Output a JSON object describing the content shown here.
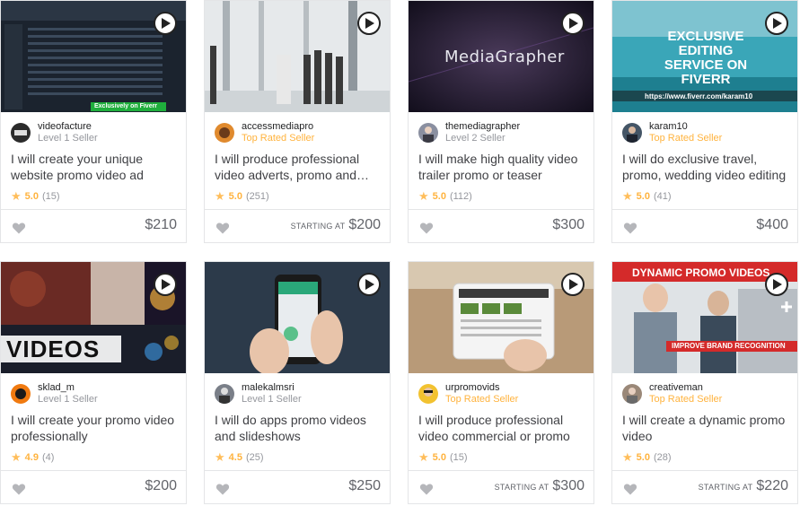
{
  "gigs": [
    {
      "seller": "videofacture",
      "level": "Level 1 Seller",
      "top_rated": false,
      "title": "I will create your unique website promo video ad",
      "rating": "5.0",
      "reviews": "(15)",
      "starting_label": "",
      "price": "$210",
      "thumb_text": "Exclusively on Fiverr",
      "thumb_bg": "#1d2733",
      "avatar_color": "#2b2b2b"
    },
    {
      "seller": "accessmediapro",
      "level": "Top Rated Seller",
      "top_rated": true,
      "title": "I will produce professional video adverts, promo and…",
      "rating": "5.0",
      "reviews": "(251)",
      "starting_label": "STARTING AT",
      "price": "$200",
      "thumb_text": "",
      "thumb_bg": "#d9dde0",
      "avatar_color": "#e08a2e"
    },
    {
      "seller": "themediagrapher",
      "level": "Level 2 Seller",
      "top_rated": false,
      "title": "I will make high quality video trailer promo or teaser",
      "rating": "5.0",
      "reviews": "(112)",
      "starting_label": "",
      "price": "$300",
      "thumb_text": "MediaGrapher",
      "thumb_bg": "#2a1f3a",
      "avatar_color": "#8a8fa0"
    },
    {
      "seller": "karam10",
      "level": "Top Rated Seller",
      "top_rated": true,
      "title": "I will do exclusive travel, promo, wedding video editing",
      "rating": "5.0",
      "reviews": "(41)",
      "starting_label": "",
      "price": "$400",
      "thumb_text": "EXCLUSIVE EDITING SERVICE ON FIVERR",
      "thumb_sub": "https://www.fiverr.com/karam10",
      "thumb_bg": "#2a8fa0",
      "avatar_color": "#445566"
    },
    {
      "seller": "sklad_m",
      "level": "Level 1 Seller",
      "top_rated": false,
      "title": "I will create your promo video professionally",
      "rating": "4.9",
      "reviews": "(4)",
      "starting_label": "",
      "price": "$200",
      "thumb_text": "VIDEOS",
      "thumb_bg": "#3a1e2a",
      "avatar_color": "#f07a10"
    },
    {
      "seller": "malekalmsri",
      "level": "Level 1 Seller",
      "top_rated": false,
      "title": "I will do apps promo videos and slideshows",
      "rating": "4.5",
      "reviews": "(25)",
      "starting_label": "",
      "price": "$250",
      "thumb_text": "",
      "thumb_bg": "#2a3a4a",
      "avatar_color": "#7a7f88"
    },
    {
      "seller": "urpromovids",
      "level": "Top Rated Seller",
      "top_rated": true,
      "title": "I will produce professional video commercial or promo",
      "rating": "5.0",
      "reviews": "(15)",
      "starting_label": "STARTING AT",
      "price": "$300",
      "thumb_text": "",
      "thumb_bg": "#c9b49a",
      "avatar_color": "#f2c230"
    },
    {
      "seller": "creativeman",
      "level": "Top Rated Seller",
      "top_rated": true,
      "title": "I will create a dynamic promo video",
      "rating": "5.0",
      "reviews": "(28)",
      "starting_label": "STARTING AT",
      "price": "$220",
      "thumb_text": "DYNAMIC PROMO VIDEOS",
      "thumb_sub": "IMPROVE BRAND RECOGNITION",
      "thumb_bg": "#cfd3d8",
      "avatar_color": "#9a8878"
    }
  ]
}
